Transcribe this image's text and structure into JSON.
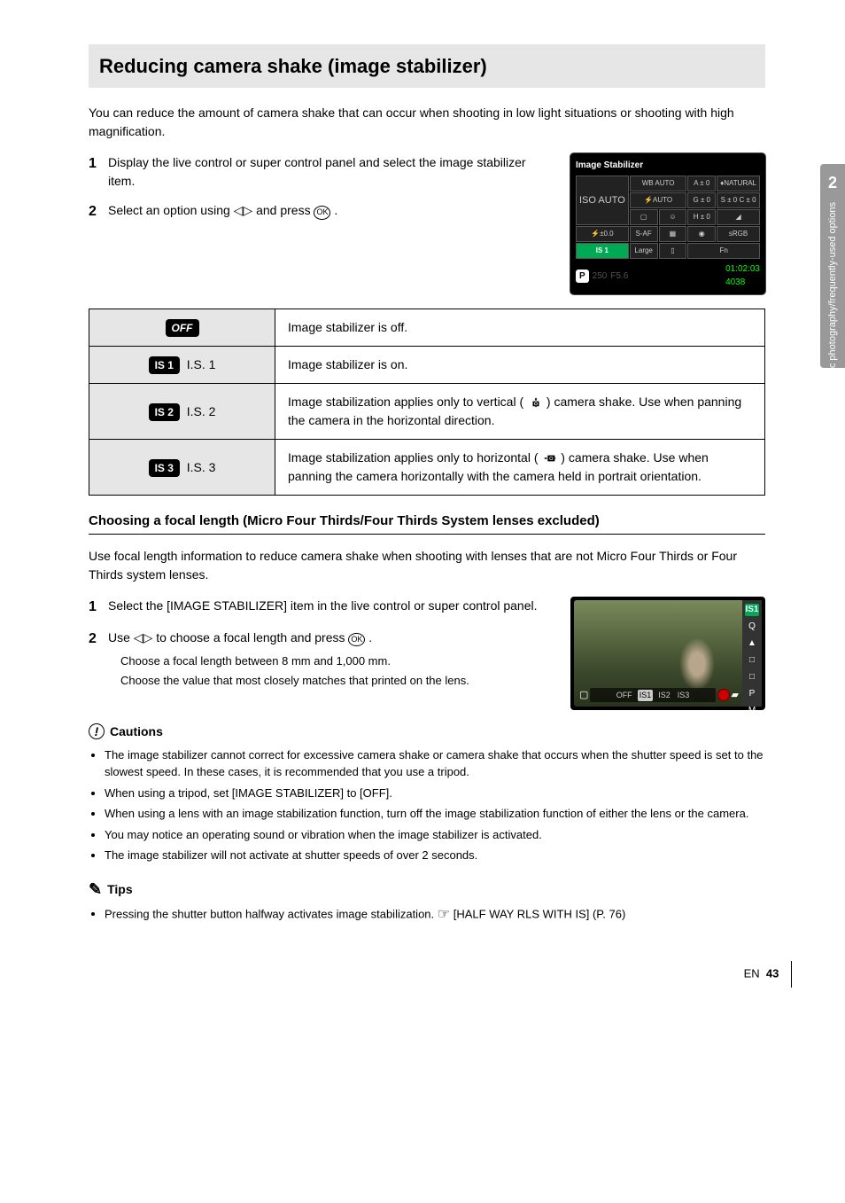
{
  "side_tab": {
    "num": "2",
    "label": "Basic photography/frequently-used options"
  },
  "title": "Reducing camera shake (image stabilizer)",
  "intro": "You can reduce the amount of camera shake that can occur when shooting in low light situations or shooting with high magnification.",
  "step1": {
    "num": "1",
    "text": "Display the live control or super control panel and select the image stabilizer item."
  },
  "step2": {
    "num": "2",
    "text_a": "Select an option using ",
    "left_right": "◁▷",
    "text_b": " and press ",
    "ok": "OK",
    "text_c": "."
  },
  "super_panel": {
    "title": "Image Stabilizer",
    "cells": {
      "wb": "WB",
      "auto": "AUTO",
      "flashauto": "⚡AUTO",
      "saf": "S-AF",
      "large": "Large",
      "a0": "A ± 0",
      "g0": "G ± 0",
      "nat": "♦NATURAL",
      "s0": "S ± 0",
      "c0": "C ± 0",
      "h0": "H ± 0",
      "fn": "Fn",
      "srgb": "sRGB",
      "fcomp": "⚡±0.0",
      "iso": "ISO\nAUTO",
      "sel": "IS 1"
    },
    "footer": {
      "p": "P",
      "shutter": "250",
      "ap": "F5.6",
      "date": "01:02:03",
      "shots": "4038"
    }
  },
  "modes": [
    {
      "badge": "OFF",
      "label": "",
      "desc": "Image stabilizer is off."
    },
    {
      "badge": "IS 1",
      "label": "I.S. 1",
      "desc": "Image stabilizer is on."
    },
    {
      "badge": "IS 2",
      "label": "I.S. 2",
      "desc_a": "Image stabilization applies only to vertical (",
      "desc_b": ") camera shake. Use when panning the camera in the horizontal direction."
    },
    {
      "badge": "IS 3",
      "label": "I.S. 3",
      "desc_a": "Image stabilization applies only to horizontal (",
      "desc_b": ") camera shake. Use when panning the camera horizontally with the camera held in portrait orientation."
    }
  ],
  "focal": {
    "heading": "Choosing a focal length (Micro Four Thirds/Four Thirds System lenses excluded)",
    "desc": "Use focal length information to reduce camera shake when shooting with lenses that are not Micro Four Thirds or Four Thirds system lenses.",
    "steps": [
      {
        "n": "1",
        "text": "Select the [IMAGE STABILIZER] item in the live control or super control panel."
      },
      {
        "n": "2",
        "text_a": "Use ",
        "glyph": "◁▷",
        "text_b": " to choose a focal length and press ",
        "ok": "OK",
        "text_c": ".",
        "bullets": [
          "Choose a focal length between 8 mm and 1,000 mm.",
          "Choose the value that most closely matches that printed on the lens."
        ]
      }
    ]
  },
  "live": {
    "options": [
      "OFF",
      "IS1",
      "IS2",
      "IS3"
    ],
    "current": "IS1",
    "side": [
      "IS1",
      "Q",
      "▲",
      "□",
      "□",
      "P",
      "M"
    ]
  },
  "cautions_title": "Cautions",
  "cautions": [
    "The image stabilizer cannot correct for excessive camera shake or camera shake that occurs when the shutter speed is set to the slowest speed. In these cases, it is recommended that you use a tripod.",
    "When using a tripod, set [IMAGE STABILIZER] to [OFF].",
    "When using a lens with an image stabilization function, turn off the image stabilization function of either the lens or the camera.",
    "You may notice an operating sound or vibration when the image stabilizer is activated.",
    "The image stabilizer will not activate at shutter speeds of over 2 seconds."
  ],
  "tips_title": "Tips",
  "tips_text_a": "Pressing the shutter button halfway activates image stabilization. ",
  "tips_ref_label": "[HALF WAY RLS WITH IS] (P. 76)",
  "page_label": "EN",
  "page_num": "43"
}
